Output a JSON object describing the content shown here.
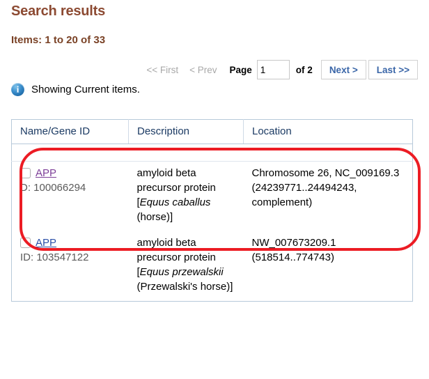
{
  "header": {
    "title": "Search results",
    "items_count": "Items: 1 to 20 of 33"
  },
  "pagination": {
    "first_label": "<< First",
    "prev_label": "< Prev",
    "page_label": "Page",
    "page_value": "1",
    "of_label": "of 2",
    "next_label": "Next >",
    "last_label": "Last >>"
  },
  "notice": {
    "icon": "info-icon",
    "text": "Showing Current items."
  },
  "table": {
    "columns": [
      "Name/Gene ID",
      "Description",
      "Location"
    ],
    "rows": [
      {
        "name": "APP",
        "id": "D: 100066294",
        "desc_pre": "amyloid beta precursor protein [",
        "desc_species": "Equus caballus",
        "desc_post": " (horse)]",
        "location": "Chromosome 26, NC_009169.3 (24239771..24494243, complement)"
      },
      {
        "name": "APP",
        "id": "ID: 103547122",
        "desc_pre": "amyloid beta precursor protein [",
        "desc_species": "Equus przewalskii",
        "desc_post": " (Przewalski's horse)]",
        "location": "NW_007673209.1 (518514..774743)"
      }
    ]
  },
  "annotation": {
    "shape": "rounded-rectangle",
    "color": "#ec1c24",
    "targets_row_index": 0
  },
  "colors": {
    "heading": "#8c4a32",
    "link": "#2a4fa8",
    "visited_link": "#7d3f98",
    "header_text": "#1b3a63",
    "annotation": "#ec1c24"
  }
}
